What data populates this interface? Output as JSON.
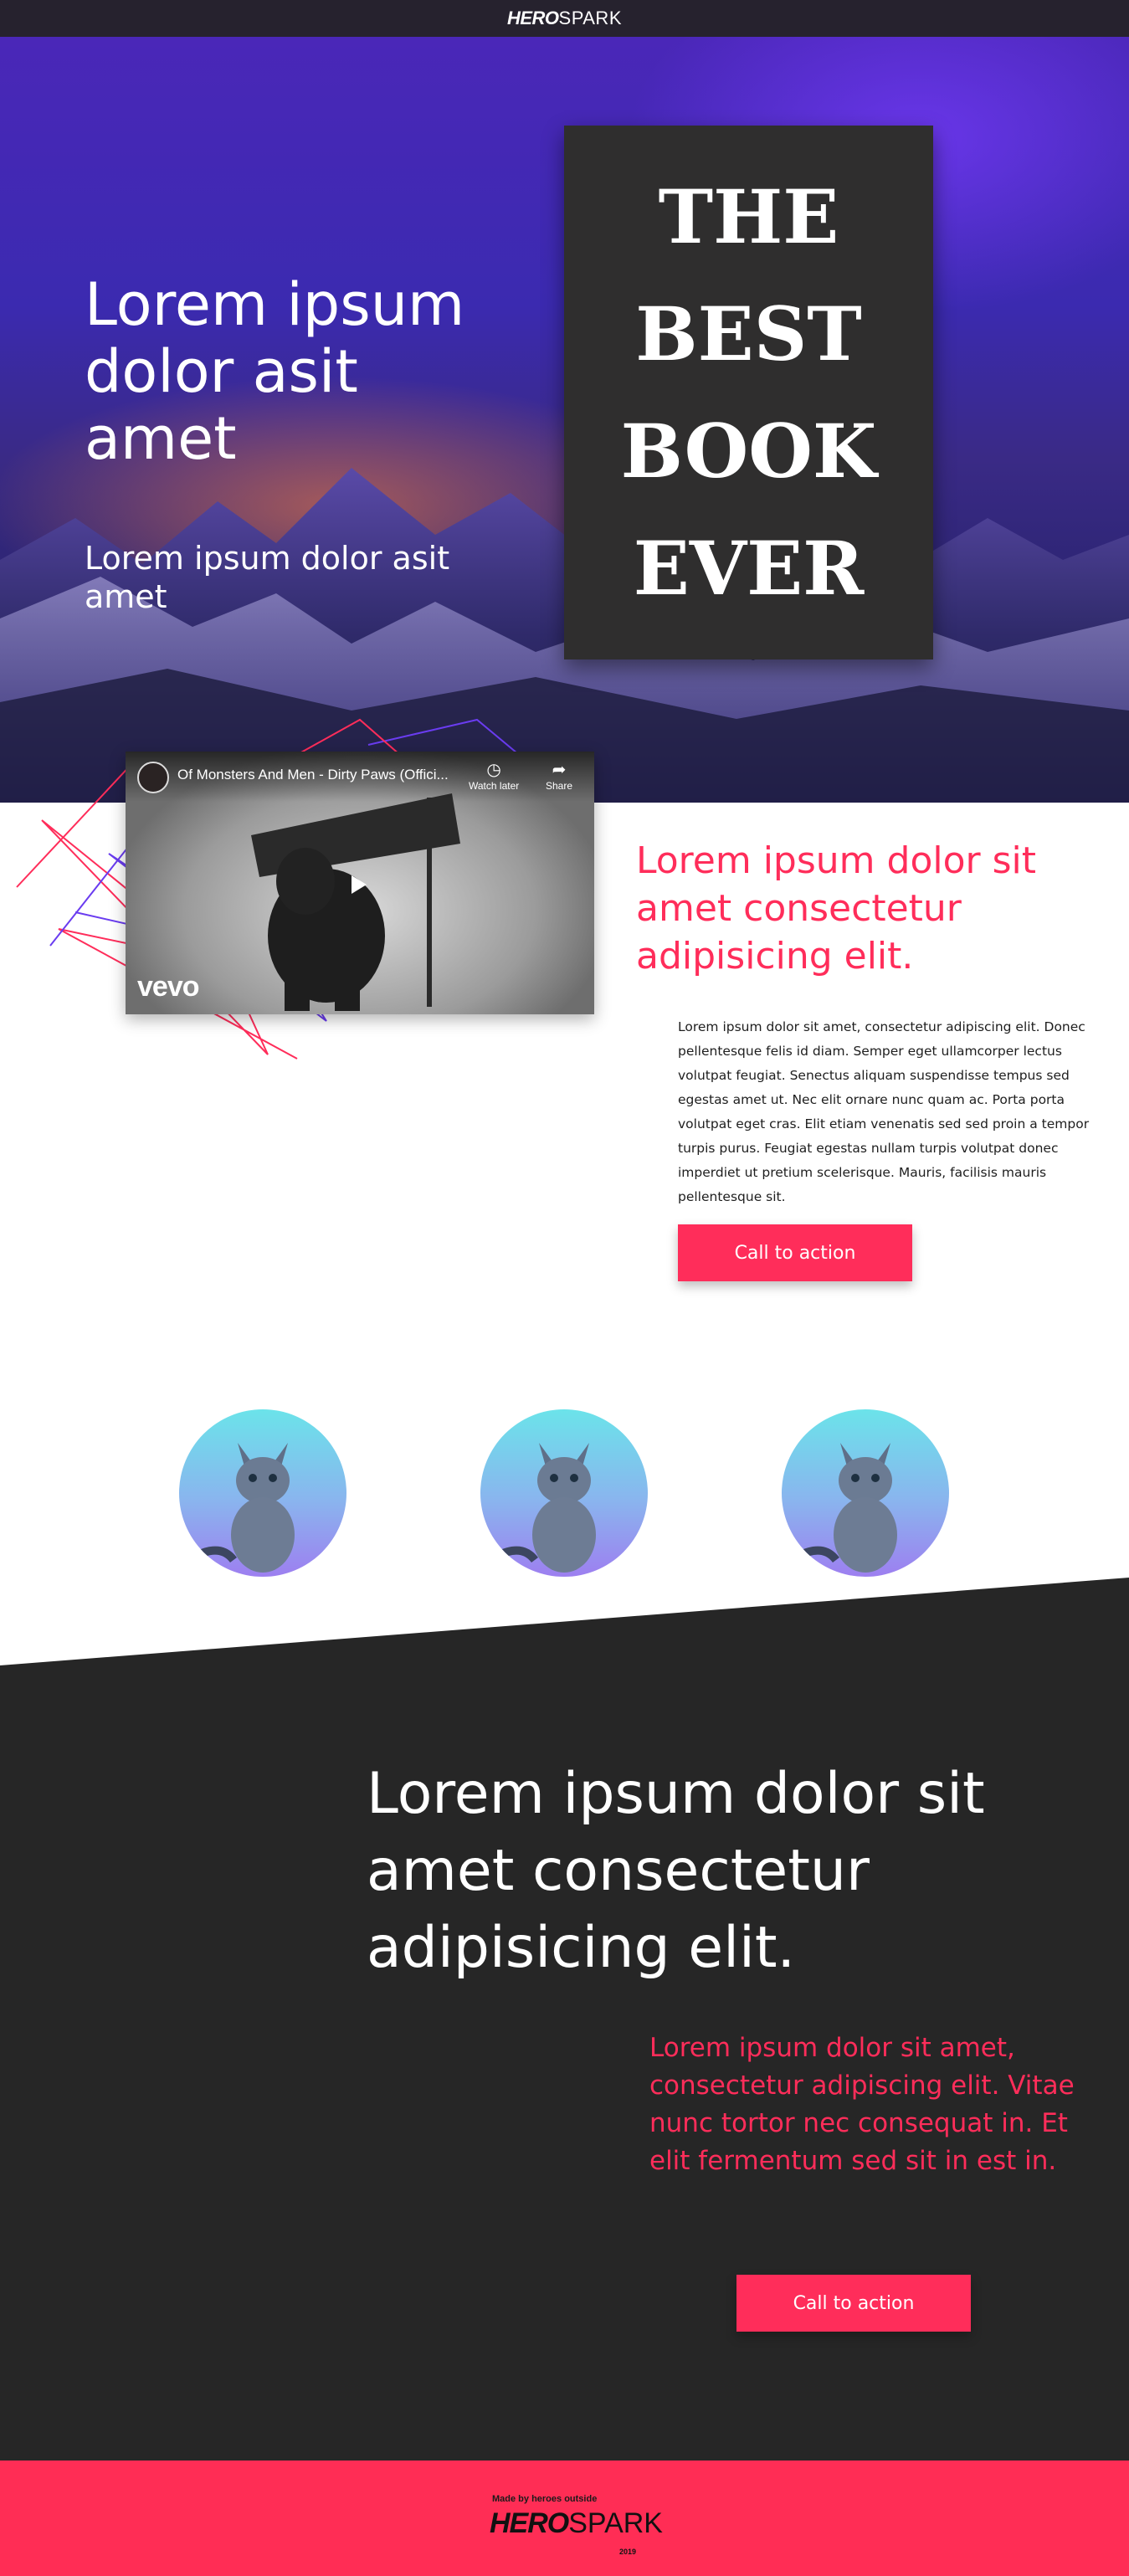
{
  "header": {
    "logo_bold": "HERO",
    "logo_regular": "SPARK"
  },
  "hero": {
    "title": "Lorem ipsum dolor asit amet",
    "subtitle": "Lorem ipsum dolor asit amet",
    "book_lines": [
      "THE",
      "BEST",
      "BOOK",
      "EVER"
    ]
  },
  "video": {
    "title": "Of Monsters And Men - Dirty Paws (Offici...",
    "watch_later": "Watch later",
    "share": "Share",
    "brand": "vevo"
  },
  "feature": {
    "title": "Lorem ipsum dolor sit amet consectetur adipisicing elit.",
    "paragraph": "Lorem ipsum dolor sit amet, consectetur adipiscing elit. Donec pellentesque felis id diam. Semper eget ullamcorper lectus volutpat feugiat. Senectus aliquam suspendisse tempus sed egestas amet ut. Nec elit ornare nunc quam ac. Porta porta volutpat eget cras. Elit etiam venenatis sed sed proin a tempor turpis purus. Feugiat egestas nullam turpis volutpat donec imperdiet ut pretium scelerisque. Mauris, facilisis mauris pellentesque sit.",
    "cta": "Call to action"
  },
  "dark_section": {
    "title": "Lorem ipsum dolor sit amet consectetur adipisicing elit.",
    "subtitle": "Lorem ipsum dolor sit amet, consectetur adipiscing elit. Vitae nunc tortor nec consequat in. Et elit fermentum sed sit in est in.",
    "cta": "Call to action"
  },
  "footer": {
    "made_by": "Made by heroes outside",
    "logo_bold": "HERO",
    "logo_regular": "SPARK",
    "year": "2019"
  },
  "colors": {
    "accent": "#ff2d5a",
    "dark_bg": "#262626",
    "topbar": "#26222e",
    "book": "#2f2e2e"
  }
}
